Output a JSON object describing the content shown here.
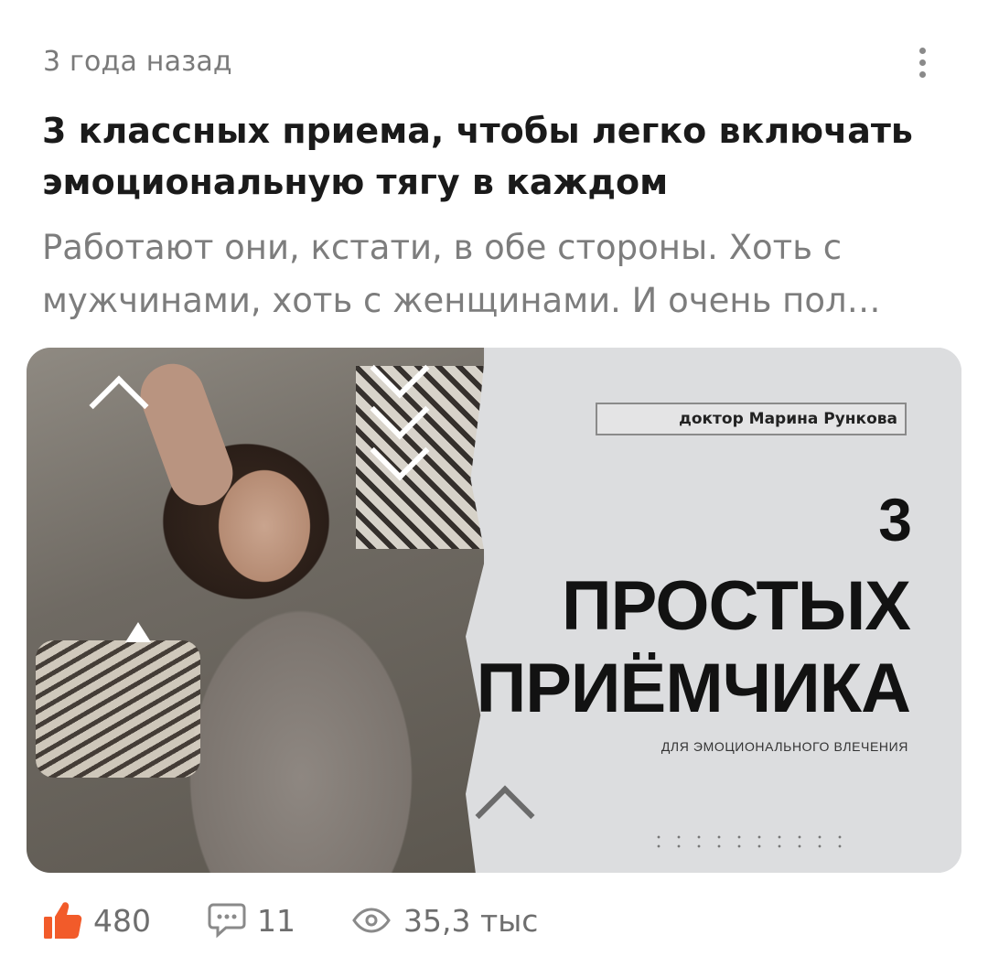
{
  "post": {
    "time_ago": "3 года назад",
    "title": "3 классных приема, чтобы легко включать эмоциональную тягу в каждом",
    "snippet_line1": "Работают они, кстати, в обе стороны. Хоть с",
    "snippet_line2": "мужчинами, хоть с женщинами. И очень пол…"
  },
  "cover": {
    "author": "доктор Марина Рункова",
    "number": "3",
    "headline_line1": "ПРОСТЫХ",
    "headline_line2": "ПРИЁМЧИКА",
    "caption": "ДЛЯ ЭМОЦИОНАЛЬНОГО ВЛЕЧЕНИЯ"
  },
  "stats": {
    "likes": "480",
    "comments": "11",
    "views": "35,3 тыс"
  },
  "icons": {
    "more": "more-vertical-icon",
    "like": "thumbs-up-icon",
    "comment": "comment-icon",
    "views": "eye-icon"
  },
  "colors": {
    "like_accent": "#f25b2a",
    "muted_text": "#7a7a7a",
    "title_text": "#1a1a1a"
  }
}
